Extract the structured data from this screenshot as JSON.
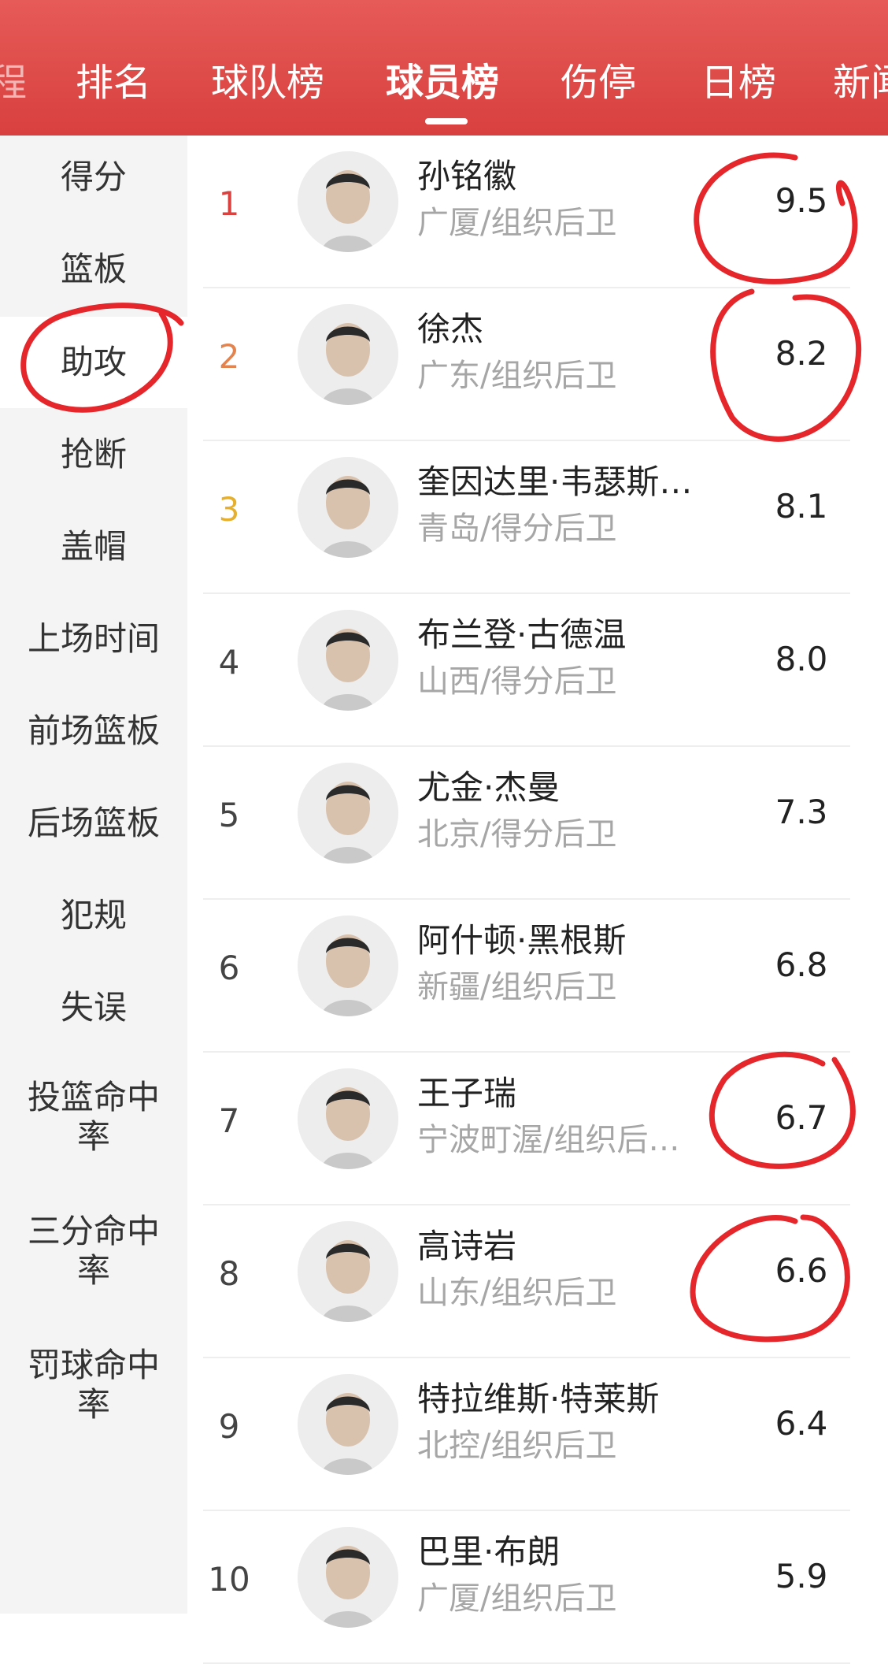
{
  "nav": {
    "tabs": [
      "排名",
      "球队榜",
      "球员榜",
      "伤停",
      "日榜",
      "新闻"
    ],
    "active_index": 2,
    "left_partial": "程"
  },
  "sidebar": {
    "items": [
      "得分",
      "篮板",
      "助攻",
      "抢断",
      "盖帽",
      "上场时间",
      "前场篮板",
      "后场篮板",
      "犯规",
      "失误",
      "投篮命中率",
      "三分命中率",
      "罚球命中率"
    ],
    "selected_index": 2
  },
  "players": [
    {
      "rank": "1",
      "name": "孙铭徽",
      "team_position": "广厦/组织后卫",
      "value": "9.5"
    },
    {
      "rank": "2",
      "name": "徐杰",
      "team_position": "广东/组织后卫",
      "value": "8.2"
    },
    {
      "rank": "3",
      "name": "奎因达里·韦瑟斯…",
      "team_position": "青岛/得分后卫",
      "value": "8.1"
    },
    {
      "rank": "4",
      "name": "布兰登·古德温",
      "team_position": "山西/得分后卫",
      "value": "8.0"
    },
    {
      "rank": "5",
      "name": "尤金·杰曼",
      "team_position": "北京/得分后卫",
      "value": "7.3"
    },
    {
      "rank": "6",
      "name": "阿什顿·黑根斯",
      "team_position": "新疆/组织后卫",
      "value": "6.8"
    },
    {
      "rank": "7",
      "name": "王子瑞",
      "team_position": "宁波町渥/组织后…",
      "value": "6.7"
    },
    {
      "rank": "8",
      "name": "高诗岩",
      "team_position": "山东/组织后卫",
      "value": "6.6"
    },
    {
      "rank": "9",
      "name": "特拉维斯·特莱斯",
      "team_position": "北控/组织后卫",
      "value": "6.4"
    },
    {
      "rank": "10",
      "name": "巴里·布朗",
      "team_position": "广厦/组织后卫",
      "value": "5.9"
    }
  ],
  "colors": {
    "nav_red": "#e0504d",
    "annotation_red": "#e5262a",
    "rank1": "#d9423f",
    "rank2": "#e3834e",
    "rank3": "#e7b02c"
  }
}
